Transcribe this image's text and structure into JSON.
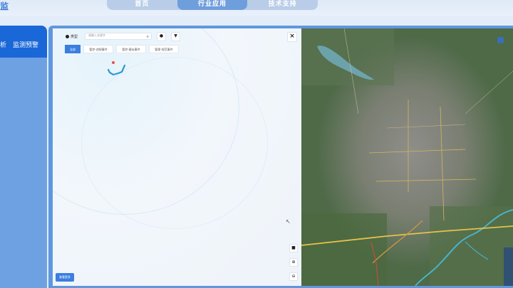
{
  "nav": {
    "tabs": [
      {
        "label": "首页",
        "active": false
      },
      {
        "label": "行业应用",
        "active": true
      },
      {
        "label": "技术支持",
        "active": false
      }
    ]
  },
  "header": {
    "partial_title": "监"
  },
  "sidebar": {
    "items": [
      {
        "label": "析"
      },
      {
        "label": "监测预警"
      }
    ]
  },
  "panel": {
    "category_label": "类型",
    "search": {
      "placeholder": "请输入关键字"
    },
    "filters": [
      {
        "label": "全部",
        "active": true
      },
      {
        "label": "管控-违规事件",
        "active": false
      },
      {
        "label": "管控-疑似事件",
        "active": false
      },
      {
        "label": "管理-规范事件",
        "active": false
      }
    ],
    "bottom_button": "查看更多"
  },
  "colors": {
    "accent": "#3b7ee0",
    "sidebar_dark": "#1a67d8",
    "sidebar_light": "#6ea1e2",
    "frame": "#5f97de"
  }
}
